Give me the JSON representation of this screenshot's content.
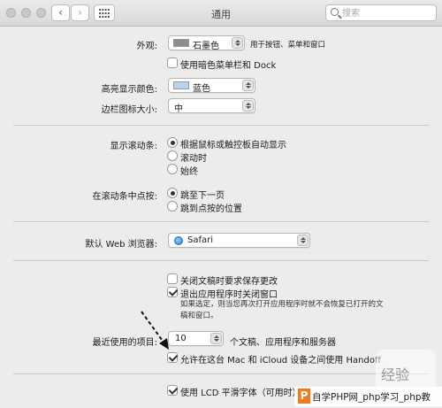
{
  "window": {
    "title": "通用",
    "search": {
      "placeholder": "搜索",
      "value": ""
    }
  },
  "appearance": {
    "label": "外观:",
    "value": "石墨色",
    "note": "用于按钮、菜单和窗口",
    "dark_menu_checkbox": {
      "label": "使用暗色菜单栏和 Dock",
      "checked": false
    }
  },
  "highlight": {
    "label": "高亮显示颜色:",
    "value": "蓝色"
  },
  "sidebar_icon": {
    "label": "边栏图标大小:",
    "value": "中"
  },
  "scrollbars": {
    "label": "显示滚动条:",
    "options": [
      "根据鼠标或触控板自动显示",
      "滚动时",
      "始终"
    ],
    "selected_index": 0
  },
  "scroll_click": {
    "label": "在滚动条中点按:",
    "options": [
      "跳至下一页",
      "跳到点按的位置"
    ],
    "selected_index": 0
  },
  "browser": {
    "label": "默认 Web 浏览器:",
    "value": "Safari"
  },
  "documents": {
    "ask_save": {
      "label": "关闭文稿时要求保存更改",
      "checked": false
    },
    "close_windows": {
      "label": "退出应用程序时关闭窗口",
      "checked": true
    },
    "close_windows_note_1": "如果选定，则当您再次打开应用程序时就不会恢复已打开的文",
    "close_windows_note_2": "稿和窗口。"
  },
  "recent": {
    "label": "最近使用的项目:",
    "value": "10",
    "suffix": "个文稿、应用程序和服务器"
  },
  "handoff": {
    "label": "允许在这台 Mac 和 iCloud 设备之间使用 Handoff",
    "checked": true
  },
  "lcd": {
    "label": "使用 LCD 平滑字体（可用时）",
    "checked": true
  },
  "watermark": {
    "logo_letter": "P",
    "site_text": "自学PHP网_php学习_php教",
    "bubble_text": "经验"
  }
}
